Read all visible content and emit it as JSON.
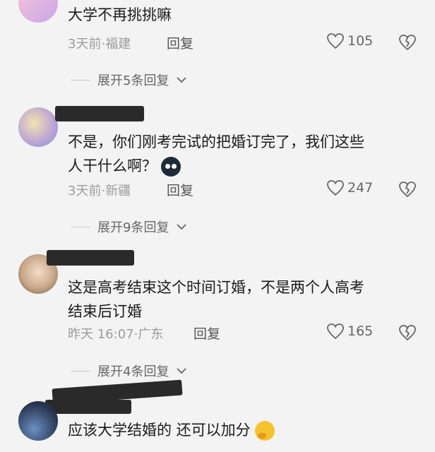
{
  "comments": [
    {
      "text_lines": [
        "大学不再挑挑嘛"
      ],
      "time": "3天前",
      "location": "福建",
      "reply_label": "回复",
      "likes": "105",
      "expand_label": "展开5条回复"
    },
    {
      "text_lines": [
        "不是，你们刚考完试的把婚订完了，我们这些",
        "人干什么啊？"
      ],
      "time": "3天前",
      "location": "新疆",
      "reply_label": "回复",
      "likes": "247",
      "expand_label": "展开9条回复"
    },
    {
      "text_lines": [
        "这是高考结束这个时间订婚，不是两个人高考",
        "结束后订婚"
      ],
      "time": "昨天 16:07",
      "location": "广东",
      "reply_label": "回复",
      "likes": "165",
      "expand_label": "展开4条回复"
    },
    {
      "text_lines": [
        "应该大学结婚的 还可以加分"
      ]
    }
  ],
  "separator": "·",
  "icons": {
    "like": "heart-outline-icon",
    "dislike": "broken-heart-icon",
    "expand": "chevron-down-icon"
  },
  "colors": {
    "background": "#f3f3f3",
    "meta_text": "#9b9b9b",
    "redaction": "#2a2a2a"
  }
}
